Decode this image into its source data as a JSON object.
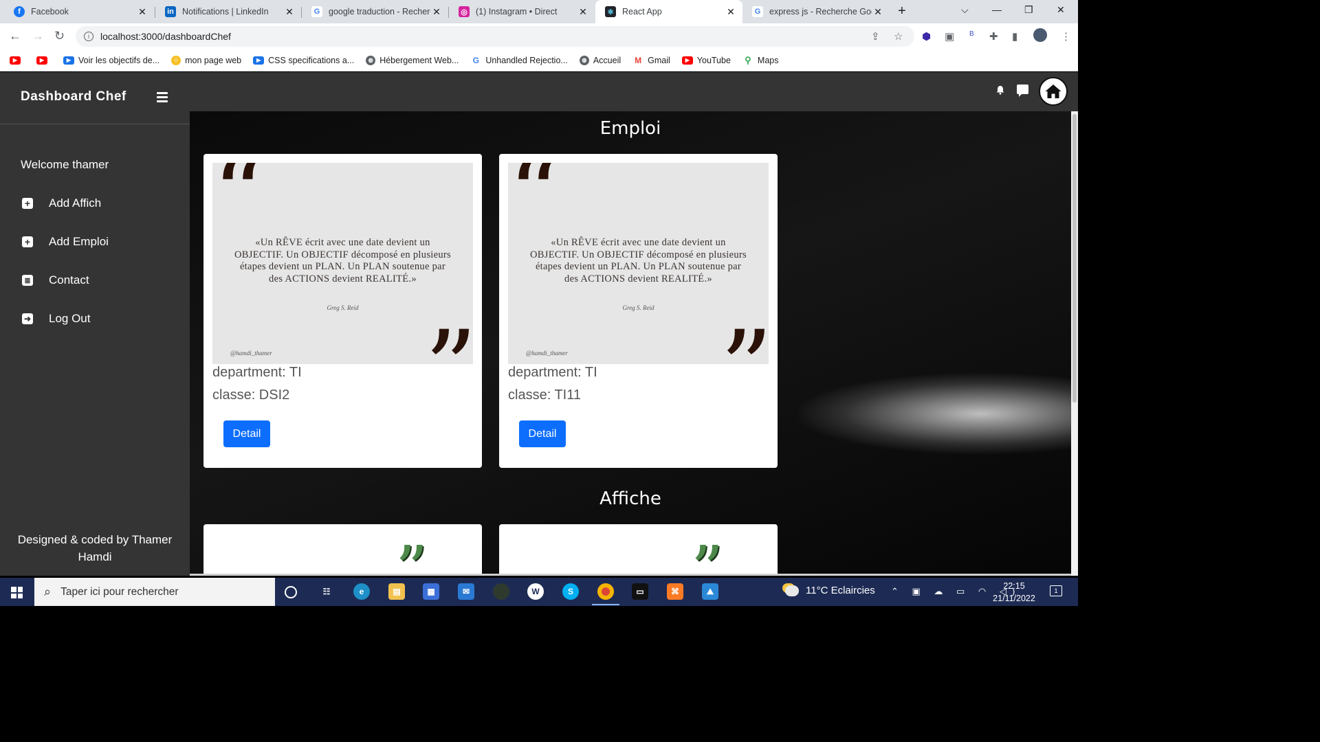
{
  "browser": {
    "tabs": [
      {
        "title": "Facebook",
        "icon": "facebook-icon",
        "color": "#1877f2",
        "glyph": "f"
      },
      {
        "title": "Notifications | LinkedIn",
        "icon": "linkedin-icon",
        "color": "#0a66c2",
        "glyph": "in"
      },
      {
        "title": "google traduction - Recherc",
        "icon": "google-icon",
        "color": "#4285f4",
        "glyph": "G"
      },
      {
        "title": "(1) Instagram • Direct",
        "icon": "instagram-icon",
        "color": "#d6249f",
        "glyph": "◎"
      },
      {
        "title": "React App",
        "icon": "react-icon",
        "color": "#20232a",
        "glyph": "⚛"
      },
      {
        "title": "express js - Recherche Goo",
        "icon": "google-icon",
        "color": "#4285f4",
        "glyph": "G"
      }
    ],
    "url": "localhost:3000/dashboardChef",
    "bookmarks": [
      {
        "label": "",
        "color": "#ff0000"
      },
      {
        "label": "",
        "color": "#ff0000"
      },
      {
        "label": "Voir les objectifs de...",
        "color": "#1a73e8"
      },
      {
        "label": "mon page web",
        "color": "#f6c026"
      },
      {
        "label": "CSS specifications a...",
        "color": "#1a73e8"
      },
      {
        "label": "Hébergement Web...",
        "color": "#5f6368"
      },
      {
        "label": "Unhandled Rejectio...",
        "color": "#4285f4"
      },
      {
        "label": "Accueil",
        "color": "#5f6368"
      },
      {
        "label": "Gmail",
        "color": "#ea4335"
      },
      {
        "label": "YouTube",
        "color": "#ff0000"
      },
      {
        "label": "Maps",
        "color": "#34a853"
      }
    ]
  },
  "sidebar": {
    "brand": "Dashboard Chef",
    "welcome": "Welcome thamer",
    "items": [
      {
        "label": "Add Affich",
        "icon": "plus-square-icon"
      },
      {
        "label": "Add Emploi",
        "icon": "plus-square-icon"
      },
      {
        "label": "Contact",
        "icon": "contact-card-icon"
      },
      {
        "label": "Log Out",
        "icon": "logout-icon"
      }
    ],
    "credit": "Designed & coded by Thamer Hamdi"
  },
  "main": {
    "emploi_title": "Emploi",
    "affiche_title": "Affiche",
    "cards": [
      {
        "quote_text": "«Un RÊVE écrit avec une date devient un OBJECTIF. Un OBJECTIF décomposé en plusieurs étapes devient un PLAN. Un PLAN soutenue par des ACTIONS devient REALITÉ.»",
        "quote_author": "Greg S. Reid",
        "quote_handle": "@hamdi_thamer",
        "department": "department: TI",
        "classe": "classe: DSI2",
        "button": "Detail"
      },
      {
        "quote_text": "«Un RÊVE écrit avec une date devient un OBJECTIF. Un OBJECTIF décomposé en plusieurs étapes devient un PLAN. Un PLAN soutenue par des ACTIONS devient REALITÉ.»",
        "quote_author": "Greg S. Reid",
        "quote_handle": "@hamdi_thamer",
        "department": "department: TI",
        "classe": "classe: TI11",
        "button": "Detail"
      }
    ]
  },
  "taskbar": {
    "search_placeholder": "Taper ici pour rechercher",
    "weather": "11°C  Eclaircies",
    "time": "22:15",
    "date": "21/11/2022",
    "notifications": "1"
  }
}
